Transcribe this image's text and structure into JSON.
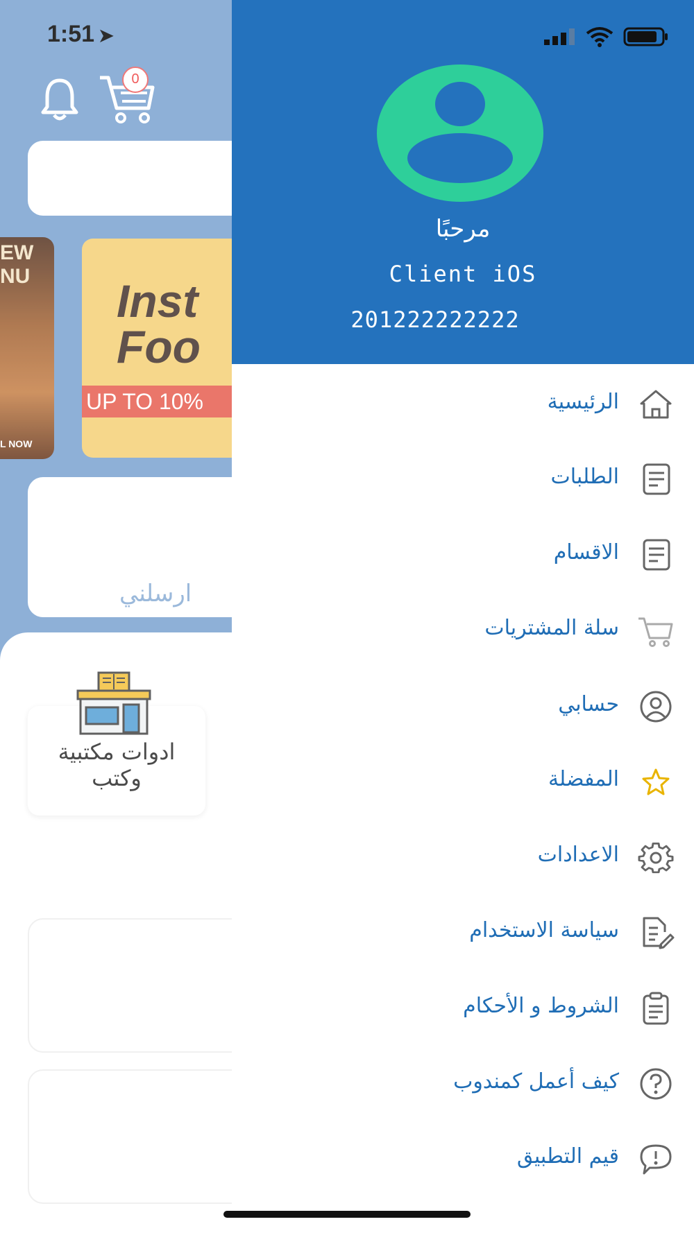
{
  "status_bar": {
    "time": "1:51",
    "location_arrow": "location-arrow-icon"
  },
  "background_app": {
    "cart_badge_count": "0",
    "banner_left": {
      "line1": "EW",
      "line2": "NU",
      "bottom": "L NOW"
    },
    "banner_main": {
      "line1": "Inst",
      "line2": "Foo",
      "strip": "UP TO 10%"
    },
    "send_label": "ارسلني",
    "category_label_line1": "ادوات مكتبية",
    "category_label_line2": "وكتب"
  },
  "drawer": {
    "greeting": "مرحبًا",
    "user_name": "Client iOS",
    "user_phone": "201222222222",
    "header_color": "#2472bd",
    "avatar_color": "#2ecf9a",
    "menu": [
      {
        "label": "الرئيسية",
        "icon": "home-icon"
      },
      {
        "label": "الطلبات",
        "icon": "document-icon"
      },
      {
        "label": "الاقسام",
        "icon": "document-icon"
      },
      {
        "label": "سلة المشتريات",
        "icon": "cart-icon"
      },
      {
        "label": "حسابي",
        "icon": "user-circle-icon"
      },
      {
        "label": "المفضلة",
        "icon": "star-icon"
      },
      {
        "label": "الاعدادات",
        "icon": "gear-icon"
      },
      {
        "label": "سياسة الاستخدام",
        "icon": "edit-document-icon"
      },
      {
        "label": "الشروط و الأحكام",
        "icon": "clipboard-icon"
      },
      {
        "label": "كيف أعمل كمندوب",
        "icon": "question-icon"
      },
      {
        "label": "قيم التطبيق",
        "icon": "feedback-icon"
      }
    ]
  }
}
